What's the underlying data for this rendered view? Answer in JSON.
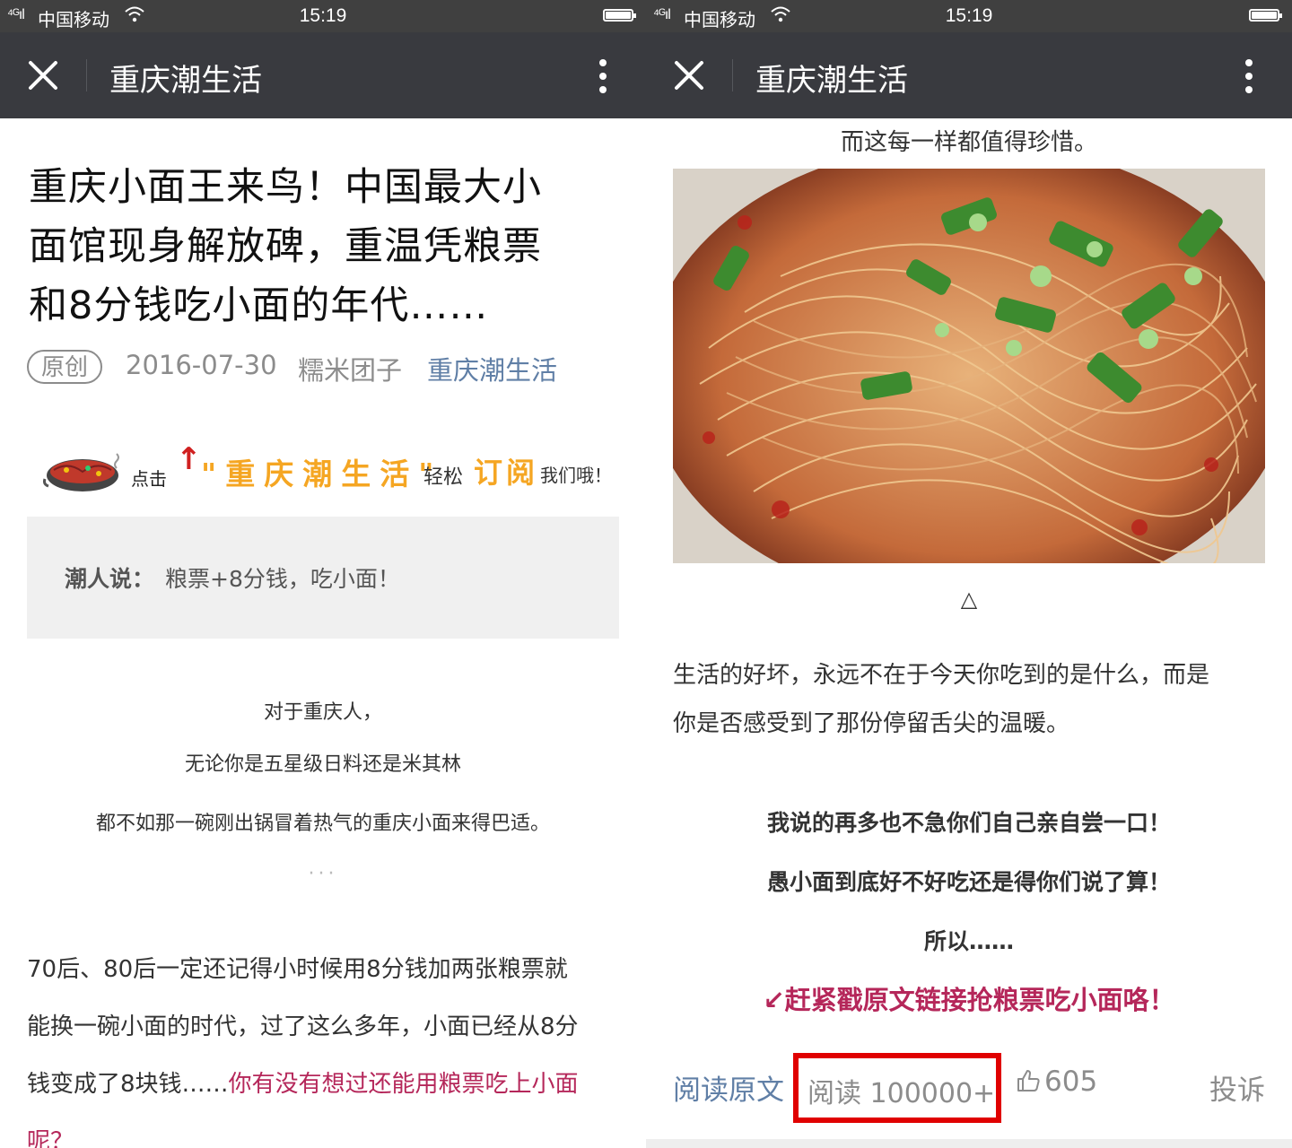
{
  "status_bar": {
    "signal": "⁴ᴳıl",
    "carrier": "中国移动",
    "time": "15:19"
  },
  "nav": {
    "title": "重庆潮生活"
  },
  "left": {
    "article": {
      "title_lines": [
        "重庆小面王来鸟！中国最大小",
        "面馆现身解放碑，重温凭粮票",
        "和8分钱吃小面的年代……"
      ],
      "badge": "原创",
      "date": "2016-07-30",
      "author": "糯米团子",
      "account": "重庆潮生活"
    },
    "banner": {
      "click": "点击",
      "arrow": "↑",
      "name": "\"重庆潮生活\"",
      "easy": "轻松",
      "subscribe": "订阅",
      "us": "我们哦！"
    },
    "quote": {
      "label": "潮人说：",
      "text": "粮票+8分钱，吃小面！"
    },
    "center_lines": [
      "对于重庆人，",
      "无论你是五星级日料还是米其林",
      "都不如那一碗刚出锅冒着热气的重庆小面来得巴适。"
    ],
    "ellipsis": "···",
    "paragraph": {
      "line1": "70后、80后一定还记得小时候用8分钱加两张粮票就",
      "line2": "能换一碗小面的时代，过了这么多年，小面已经从8分",
      "line3_plain": "钱变成了8块钱……",
      "line3_red": "你有没有想过还能用粮票吃上小面",
      "line4_red": "呢？"
    }
  },
  "right": {
    "caption_top": "而这每一样都值得珍惜。",
    "triangle": "△",
    "paragraph_lines": [
      "生活的好坏，永远不在于今天你吃到的是什么，而是",
      "你是否感受到了那份停留舌尖的温暖。"
    ],
    "bold_lines": [
      "我说的再多也不急你们自己亲自尝一口！",
      "愚小面到底好不好吃还是得你们说了算！",
      "所以……"
    ],
    "red_line": "↙赶紧戳原文链接抢粮票吃小面咯！",
    "footer": {
      "read_original": "阅读原文",
      "reads": "阅读 100000+",
      "likes": "605",
      "report": "投诉"
    }
  },
  "colors": {
    "status_bar": "#404040",
    "nav_bar": "#393a3f",
    "link_blue": "#607fa6",
    "accent_red": "#b5275a",
    "highlight_box": "#e00000",
    "banner_orange": "#f5a623"
  }
}
